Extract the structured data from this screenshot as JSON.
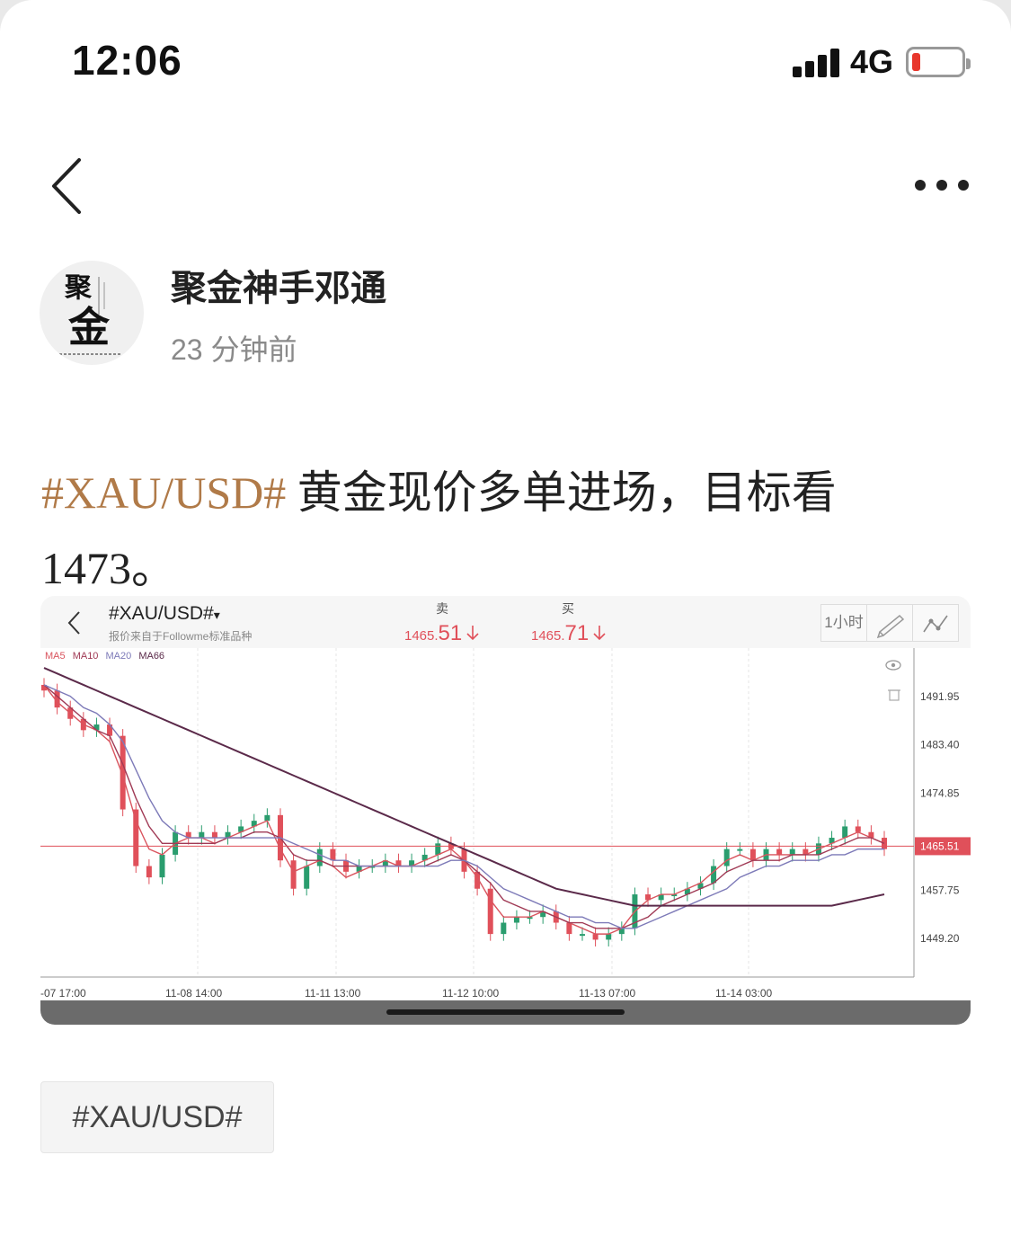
{
  "status_bar": {
    "time": "12:06",
    "network": "4G"
  },
  "author": {
    "name": "聚金神手邓通",
    "time_ago": "23 分钟前",
    "avatar_chars": [
      "聚",
      "金"
    ]
  },
  "post": {
    "hashtag": "#XAU/USD#",
    "text": "黄金现价多单进场，目标看",
    "text_line2": "1473。"
  },
  "chart_header": {
    "symbol": "#XAU/USD#",
    "dropdown_arrow": "▾",
    "subtitle": "报价来自于Followme标准品种",
    "sell_label": "卖",
    "sell_price_prefix": "1465.",
    "sell_price_suffix": "51",
    "buy_label": "买",
    "buy_price_prefix": "1465.",
    "buy_price_suffix": "71",
    "timeframe": "1小时"
  },
  "ma_legend": [
    {
      "name": "MA5",
      "color": "#d9545e"
    },
    {
      "name": "MA10",
      "color": "#a03a55"
    },
    {
      "name": "MA20",
      "color": "#7d7ab8"
    },
    {
      "name": "MA66",
      "color": "#5b2a4a"
    }
  ],
  "colors": {
    "up": "#2a9d6e",
    "down": "#e0505a",
    "tag": "#b07a48"
  },
  "chart_data": {
    "type": "line",
    "title": "",
    "y_ticks": [
      "1491.95",
      "1483.40",
      "1474.85",
      "1465.51",
      "1457.75",
      "1449.20"
    ],
    "x_ticks": [
      "-07 17:00",
      "11-08 14:00",
      "11-11 13:00",
      "11-12 10:00",
      "11-13 07:00",
      "11-14 03:00"
    ],
    "ylim": [
      1442.4,
      1500.5
    ],
    "current_price": 1465.51,
    "current_price_label": "1465.51",
    "series": [
      {
        "name": "MA5",
        "values": [
          1494,
          1491,
          1489,
          1487,
          1486,
          1484,
          1478,
          1470,
          1465,
          1464,
          1466,
          1467,
          1467,
          1466,
          1467,
          1468,
          1469,
          1470,
          1465,
          1461,
          1462,
          1463,
          1462,
          1460,
          1461,
          1462,
          1463,
          1462,
          1462,
          1463,
          1464,
          1465,
          1463,
          1460,
          1456,
          1453,
          1453,
          1453,
          1454,
          1453,
          1452,
          1451,
          1450,
          1450,
          1451,
          1454,
          1456,
          1457,
          1457,
          1458,
          1459,
          1461,
          1463,
          1464,
          1463,
          1464,
          1464,
          1464,
          1464,
          1465,
          1466,
          1467,
          1468,
          1467,
          1466
        ]
      },
      {
        "name": "MA10",
        "values": [
          1494,
          1492,
          1490,
          1488,
          1486,
          1485,
          1480,
          1474,
          1469,
          1466,
          1466,
          1466,
          1466,
          1466,
          1467,
          1467,
          1468,
          1468,
          1467,
          1464,
          1463,
          1463,
          1462,
          1462,
          1462,
          1462,
          1462,
          1462,
          1462,
          1462,
          1463,
          1464,
          1463,
          1461,
          1459,
          1456,
          1455,
          1454,
          1454,
          1453,
          1452,
          1452,
          1451,
          1451,
          1451,
          1452,
          1453,
          1455,
          1456,
          1457,
          1458,
          1459,
          1461,
          1462,
          1463,
          1463,
          1463,
          1464,
          1464,
          1464,
          1465,
          1466,
          1467,
          1467,
          1466
        ]
      },
      {
        "name": "MA20",
        "values": [
          1494,
          1493,
          1492,
          1490,
          1489,
          1487,
          1484,
          1479,
          1474,
          1470,
          1468,
          1467,
          1467,
          1467,
          1467,
          1467,
          1467,
          1467,
          1467,
          1466,
          1465,
          1464,
          1463,
          1463,
          1462,
          1462,
          1462,
          1462,
          1462,
          1462,
          1462,
          1463,
          1463,
          1462,
          1460,
          1458,
          1457,
          1456,
          1455,
          1454,
          1453,
          1453,
          1452,
          1452,
          1451,
          1451,
          1452,
          1453,
          1454,
          1455,
          1456,
          1457,
          1458,
          1460,
          1461,
          1462,
          1462,
          1463,
          1463,
          1463,
          1464,
          1464,
          1465,
          1465,
          1465
        ]
      },
      {
        "name": "MA66",
        "values": [
          1497,
          1496,
          1495,
          1494,
          1493,
          1492,
          1491,
          1490,
          1489,
          1488,
          1487,
          1486,
          1485,
          1484,
          1483,
          1482,
          1481,
          1480,
          1479,
          1478,
          1477,
          1476,
          1475,
          1474,
          1473,
          1472,
          1471,
          1470,
          1469,
          1468,
          1467,
          1466,
          1465,
          1464,
          1463,
          1462,
          1461,
          1460,
          1459,
          1458,
          1457.5,
          1457,
          1456.5,
          1456,
          1455.5,
          1455,
          1455,
          1455,
          1455,
          1455,
          1455,
          1455,
          1455,
          1455,
          1455,
          1455,
          1455,
          1455,
          1455,
          1455,
          1455,
          1455.5,
          1456,
          1456.5,
          1457
        ]
      }
    ],
    "candles_close": [
      1493,
      1490,
      1488,
      1486,
      1487,
      1485,
      1472,
      1462,
      1460,
      1464,
      1468,
      1467,
      1468,
      1467,
      1468,
      1469,
      1470,
      1471,
      1463,
      1458,
      1462,
      1465,
      1463,
      1461,
      1462,
      1462,
      1463,
      1462,
      1463,
      1464,
      1466,
      1465,
      1461,
      1458,
      1450,
      1452,
      1453,
      1453,
      1454,
      1452,
      1450,
      1450,
      1449,
      1450,
      1451,
      1457,
      1456,
      1457,
      1457,
      1458,
      1459,
      1462,
      1465,
      1465,
      1463,
      1465,
      1464,
      1465,
      1464,
      1466,
      1467,
      1469,
      1468,
      1467,
      1465
    ]
  },
  "topic": {
    "label": "#XAU/USD#"
  }
}
